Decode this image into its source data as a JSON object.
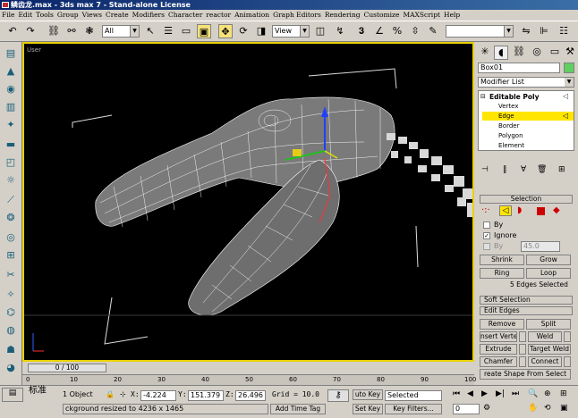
{
  "titlebar": {
    "text": "鳞齿龙.max - 3ds max 7  - Stand-alone License"
  },
  "menu": [
    "File",
    "Edit",
    "Tools",
    "Group",
    "Views",
    "Create",
    "Modifiers",
    "Character",
    "reactor",
    "Animation",
    "Graph Editors",
    "Rendering",
    "Customize",
    "MAXScript",
    "Help"
  ],
  "toolbar": {
    "selection_filter": "All",
    "ref_coord": "View"
  },
  "viewport": {
    "label": "User"
  },
  "panel": {
    "object_name": "Box01",
    "object_color": "#5fd05f",
    "modifier_list": "Modifier List",
    "stack": {
      "root": "Editable Poly",
      "items": [
        "Vertex",
        "Edge",
        "Border",
        "Polygon",
        "Element"
      ],
      "selected": "Edge"
    },
    "selection_title": "Selection",
    "by_vertex": "By",
    "ignore": "Ignore",
    "by_angle": "By",
    "angle_value": "45.0",
    "shrink": "Shrink",
    "grow": "Grow",
    "ring": "Ring",
    "loop": "Loop",
    "selected_info": "5 Edges Selected",
    "soft_selection": "Soft Selection",
    "edit_edges": "Edit Edges",
    "remove": "Remove",
    "split": "Split",
    "insert_vertex": "nsert Verte",
    "weld": "Weld",
    "extrude": "Extrude",
    "target_weld": "Target Weld",
    "chamfer": "Chamfer",
    "connect": "Connect",
    "create_shape": "reate Shape From Select"
  },
  "timeline": {
    "frame_label": "0 / 100",
    "ticks": [
      "0",
      "10",
      "20",
      "30",
      "40",
      "50",
      "60",
      "70",
      "80",
      "90",
      "100"
    ]
  },
  "status": {
    "selection": "1 Object",
    "x_label": "X:",
    "x": "-4.224",
    "y_label": "Y:",
    "y": "151.379",
    "z_label": "Z:",
    "z": "26.496",
    "grid": "Grid = 10.0",
    "auto_key": "uto Key",
    "set_key": "Set Key",
    "selected_mode": "Selected",
    "key_filters": "Key Filters...",
    "prompt": "ckground resized to 4236 x 1465",
    "add_time_tag": "Add Time Tag",
    "lang": "标准",
    "frame": "0"
  }
}
